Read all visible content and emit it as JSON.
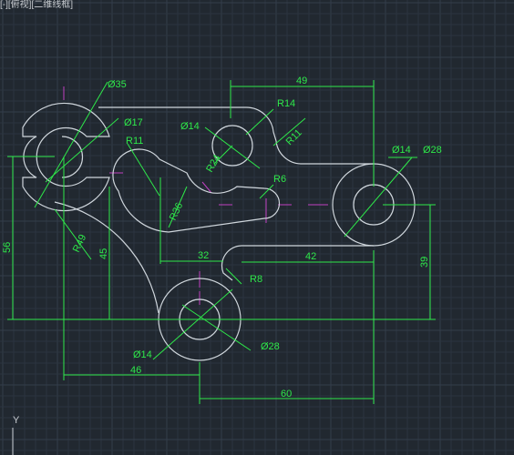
{
  "viewport": {
    "label": "[-][俯视][二维线框]",
    "ucs_axis_label": "Y"
  },
  "colors": {
    "background": "#212830",
    "geometry": "#cfd6dc",
    "dimension": "#2ee84a",
    "centerline": "#c040c0",
    "grid": "#2c3440"
  },
  "dimensions": {
    "d35": "Ø35",
    "d17": "Ø17",
    "r11_left": "R11",
    "d14_top": "Ø14",
    "r14": "R14",
    "r11_right": "R11",
    "r24": "R24",
    "r36": "R36",
    "r6": "R6",
    "d14_right": "Ø14",
    "d28_right": "Ø28",
    "r49": "R49",
    "len49": "49",
    "len32": "32",
    "len42": "42",
    "r8": "R8",
    "len56": "56",
    "len45": "45",
    "len39": "39",
    "d14_bottom": "Ø14",
    "d28_bottom": "Ø28",
    "len46": "46",
    "len60": "60"
  }
}
